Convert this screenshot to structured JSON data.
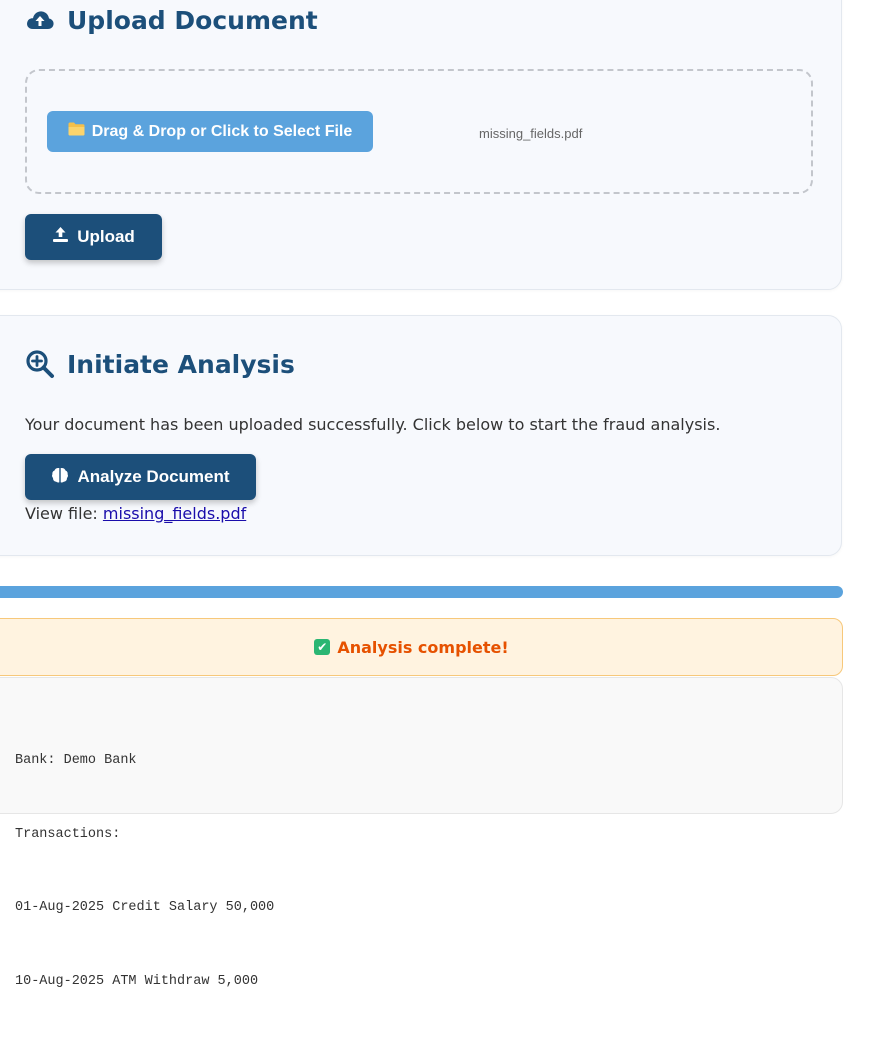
{
  "upload_section": {
    "title": "Upload Document",
    "select_button_label": "Drag & Drop or Click to Select File",
    "selected_file": "missing_fields.pdf",
    "upload_button_label": "Upload"
  },
  "analysis_section": {
    "title": "Initiate Analysis",
    "description": "Your document has been uploaded successfully. Click below to start the fraud analysis.",
    "analyze_button_label": "Analyze Document",
    "view_file_label": "View file:",
    "view_file_link": "missing_fields.pdf"
  },
  "progress": {
    "value": 1.0,
    "color": "#5ba3dd"
  },
  "status": {
    "message": "Analysis complete!",
    "icon": "check-mark-icon",
    "color": "#e65100"
  },
  "output": {
    "lines": [
      "Bank: Demo Bank",
      "Transactions:",
      "01-Aug-2025 Credit Salary 50,000",
      "10-Aug-2025 ATM Withdraw 5,000"
    ]
  },
  "icons": {
    "upload_heading": "cloud-upload-icon",
    "select_button": "folder-icon",
    "upload_button": "upload-icon",
    "analysis_heading": "search-plus-icon",
    "analyze_button": "brain-icon"
  },
  "colors": {
    "primary": "#1c4f7a",
    "accent": "#5ba3dd",
    "card_background": "#f7f9fd",
    "alert_background": "#fff3e0"
  }
}
